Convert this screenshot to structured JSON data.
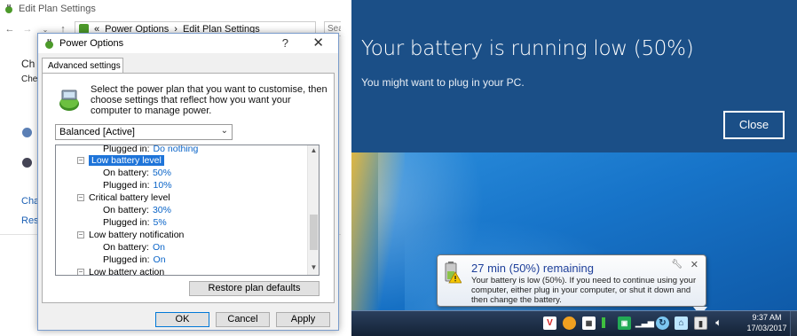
{
  "background_window": {
    "title": "Edit Plan Settings",
    "breadcrumb_prefix": "«",
    "breadcrumb": [
      "Power Options",
      "Edit Plan Settings"
    ],
    "breadcrumb_sep": "›",
    "search_placeholder": "Sea",
    "fragments": {
      "ch1": "Ch",
      "ch2": "Che",
      "cha": "Cha",
      "res": "Res"
    }
  },
  "dialog": {
    "title": "Power Options",
    "help": "?",
    "close": "✕",
    "tab": "Advanced settings",
    "description": "Select the power plan that you want to customise, then choose settings that reflect how you want your computer to manage power.",
    "plan": "Balanced [Active]",
    "settings": [
      {
        "key": "Plugged in:",
        "value": "Do nothing"
      },
      {
        "key": "Low battery level",
        "expander": "−"
      },
      {
        "key": "On battery:",
        "value": "50%"
      },
      {
        "key": "Plugged in:",
        "value": "10%"
      },
      {
        "key": "Critical battery level",
        "expander": "−"
      },
      {
        "key": "On battery:",
        "value": "30%"
      },
      {
        "key": "Plugged in:",
        "value": "5%"
      },
      {
        "key": "Low battery notification",
        "expander": "−"
      },
      {
        "key": "On battery:",
        "value": "On"
      },
      {
        "key": "Plugged in:",
        "value": "On"
      },
      {
        "key": "Low battery action",
        "expander": "−"
      }
    ],
    "restore_label": "Restore plan defaults",
    "ok_label": "OK",
    "cancel_label": "Cancel",
    "apply_label": "Apply"
  },
  "toast": {
    "title": "Your battery is running low (50%)",
    "message": "You might want to plug in your PC.",
    "close_label": "Close"
  },
  "balloon": {
    "title": "27 min (50%) remaining",
    "text": "Your battery is low (50%). If you need to continue using your computer, either plug in your computer, or shut it down and then change the battery.",
    "close": "✕"
  },
  "taskbar": {
    "time": "9:37 AM",
    "date": "17/03/2017"
  },
  "colors": {
    "toast_bg": "#1b4f87",
    "selection": "#1e74d9",
    "value_link": "#0a64c8",
    "balloon_title": "#1e3f9a"
  }
}
